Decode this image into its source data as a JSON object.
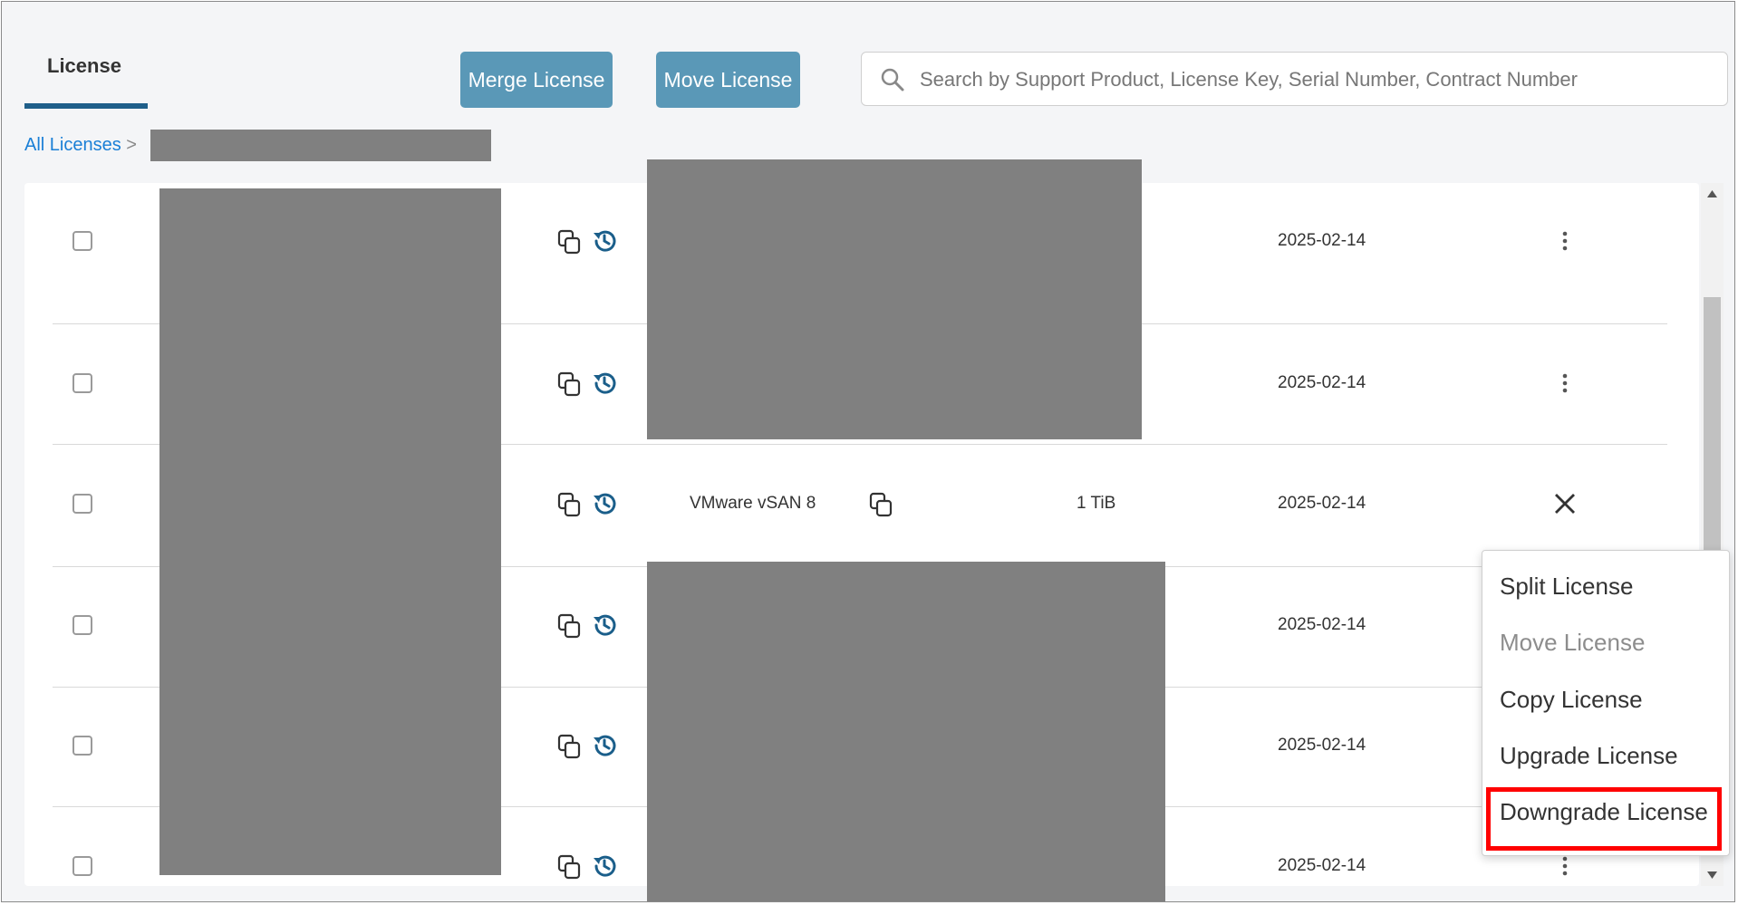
{
  "tab": {
    "label": "License"
  },
  "toolbar": {
    "merge_label": "Merge License",
    "move_label": "Move License"
  },
  "search": {
    "placeholder": "Search by Support Product, License Key, Serial Number, Contract Number"
  },
  "breadcrumb": {
    "root": "All Licenses",
    "separator": ">"
  },
  "rows": [
    {
      "date": "2025-02-14",
      "product": "",
      "capacity": "",
      "action_icon": "kebab-icon"
    },
    {
      "date": "2025-02-14",
      "product": "",
      "capacity": "",
      "action_icon": "kebab-icon"
    },
    {
      "date": "2025-02-14",
      "product": "VMware vSAN 8",
      "capacity": "1 TiB",
      "action_icon": "close-icon"
    },
    {
      "date": "2025-02-14",
      "product": "",
      "capacity": "",
      "action_icon": "kebab-icon"
    },
    {
      "date": "2025-02-14",
      "product": "",
      "capacity": "",
      "action_icon": "kebab-icon"
    },
    {
      "date": "2025-02-14",
      "product": "",
      "capacity": "",
      "action_icon": "kebab-icon"
    }
  ],
  "menu": {
    "items": [
      {
        "label": "Split License",
        "enabled": true
      },
      {
        "label": "Move License",
        "enabled": false
      },
      {
        "label": "Copy License",
        "enabled": true
      },
      {
        "label": "Upgrade License",
        "enabled": true
      },
      {
        "label": "Downgrade License",
        "enabled": true,
        "highlighted": true
      }
    ]
  },
  "colors": {
    "accent": "#1f5f8a",
    "button": "#5a98b7",
    "link": "#1a7fd6",
    "highlight": "#ff0000",
    "icon": "#1a5e8a"
  }
}
